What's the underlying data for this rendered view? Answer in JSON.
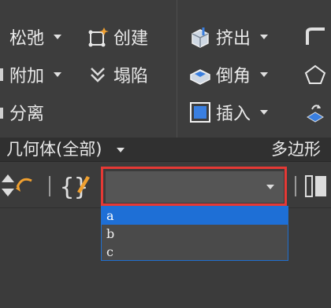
{
  "ribbon": {
    "col1": {
      "items": [
        {
          "label": "松弛",
          "icon": "relax-icon",
          "dropdown": true
        },
        {
          "label": "附加",
          "icon": "attach-icon",
          "dropdown": true
        },
        {
          "label": "分离",
          "icon": "detach-icon",
          "dropdown": false
        }
      ],
      "panel_label": "几何体(全部)"
    },
    "col2": {
      "items": [
        {
          "label": "创建",
          "icon": "create-icon"
        },
        {
          "label": "塌陷",
          "icon": "collapse-icon"
        }
      ]
    },
    "col3": {
      "items": [
        {
          "label": "挤出",
          "icon": "extrude-icon",
          "dropdown": true
        },
        {
          "label": "倒角",
          "icon": "bevel-icon",
          "dropdown": true
        },
        {
          "label": "插入",
          "icon": "inset-icon",
          "dropdown": true
        }
      ],
      "panel_label": "多边形"
    },
    "col4": {
      "items": [
        {
          "icon": "bridge-icon"
        },
        {
          "icon": "pentagon-icon"
        },
        {
          "icon": "flip-icon"
        }
      ]
    }
  },
  "toolbar": {
    "combo_value": "",
    "options": [
      "a",
      "b",
      "c"
    ],
    "selected_index": 0
  },
  "colors": {
    "highlight_outline": "#e53935",
    "selection": "#1e6fd6",
    "background": "#3b3b3b"
  }
}
